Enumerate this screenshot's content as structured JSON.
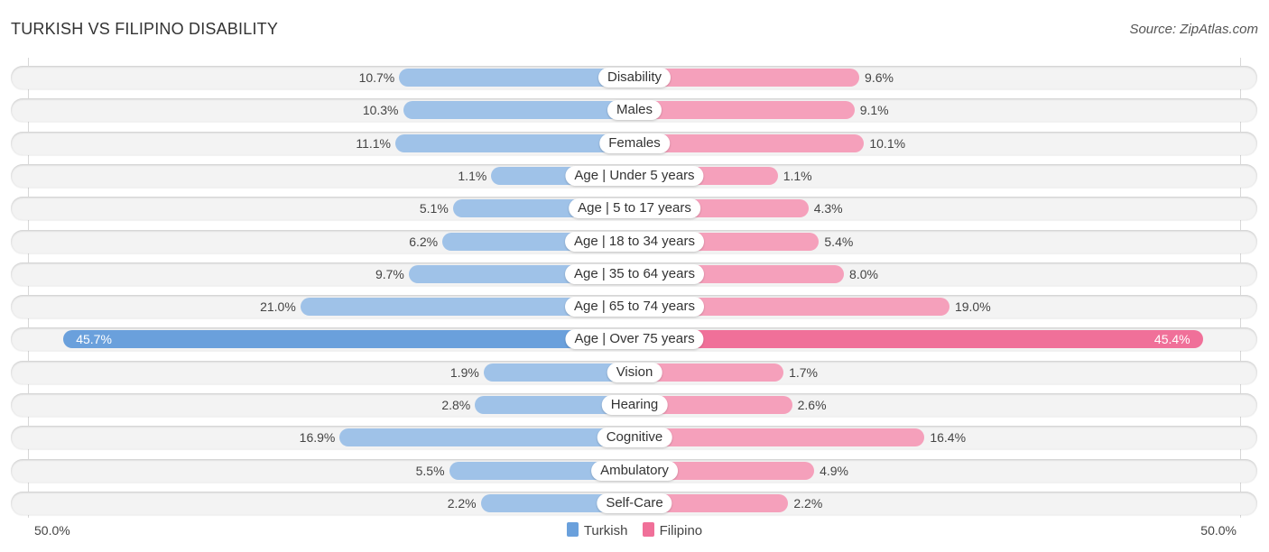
{
  "header": {
    "title": "TURKISH VS FILIPINO DISABILITY",
    "source": "Source: ZipAtlas.com"
  },
  "colors": {
    "turkish": "#9fc2e8",
    "turkish_strong": "#6aa0dc",
    "filipino": "#f5a0bb",
    "filipino_strong": "#f07099"
  },
  "chart_data": {
    "type": "bar",
    "orientation": "horizontal-diverging",
    "title": "TURKISH VS FILIPINO DISABILITY",
    "categories": [
      "Disability",
      "Males",
      "Females",
      "Age | Under 5 years",
      "Age | 5 to 17 years",
      "Age | 18 to 34 years",
      "Age | 35 to 64 years",
      "Age | 65 to 74 years",
      "Age | Over 75 years",
      "Vision",
      "Hearing",
      "Cognitive",
      "Ambulatory",
      "Self-Care"
    ],
    "series": [
      {
        "name": "Turkish",
        "side": "left",
        "values": [
          10.7,
          10.3,
          11.1,
          1.1,
          5.1,
          6.2,
          9.7,
          21.0,
          45.7,
          1.9,
          2.8,
          16.9,
          5.5,
          2.2
        ],
        "labels": [
          "10.7%",
          "10.3%",
          "11.1%",
          "1.1%",
          "5.1%",
          "6.2%",
          "9.7%",
          "21.0%",
          "45.7%",
          "1.9%",
          "2.8%",
          "16.9%",
          "5.5%",
          "2.2%"
        ]
      },
      {
        "name": "Filipino",
        "side": "right",
        "values": [
          9.6,
          9.1,
          10.1,
          1.1,
          4.3,
          5.4,
          8.0,
          19.0,
          45.4,
          1.7,
          2.6,
          16.4,
          4.9,
          2.2
        ],
        "labels": [
          "9.6%",
          "9.1%",
          "10.1%",
          "1.1%",
          "4.3%",
          "5.4%",
          "8.0%",
          "19.0%",
          "45.4%",
          "1.7%",
          "2.6%",
          "16.4%",
          "4.9%",
          "2.2%"
        ]
      }
    ],
    "xlim": [
      -50,
      50
    ],
    "axis_labels": {
      "left": "50.0%",
      "right": "50.0%"
    },
    "legend": {
      "position": "bottom-center",
      "entries": [
        "Turkish",
        "Filipino"
      ]
    },
    "highlighted_category": "Age | Over 75 years"
  }
}
